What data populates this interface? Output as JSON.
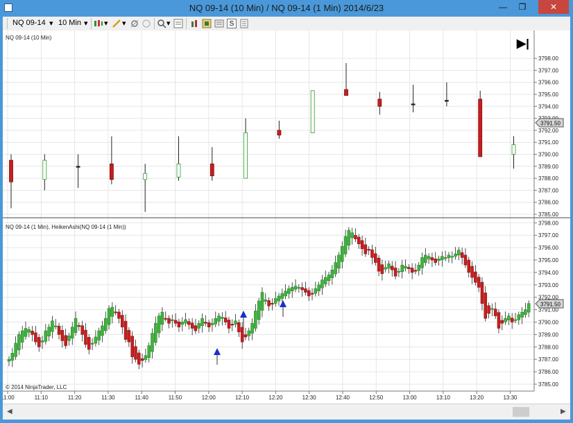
{
  "window": {
    "title": "NQ 09-14 (10 Min) / NQ 09-14 (1 Min)  2014/6/23",
    "min_glyph": "—",
    "restore_glyph": "❐",
    "close_glyph": "✕"
  },
  "toolbar": {
    "instrument": "NQ 09-14",
    "interval": "10 Min",
    "dropdown_glyph": "▾",
    "s_button": "S"
  },
  "panels": {
    "upper_label": "NQ 09-14 (10 Min)",
    "lower_label": "NQ 09-14 (1 Min), HeikenAshi(NQ 09-14 (1 Min))",
    "copyright": "© 2014 NinjaTrader, LLC",
    "price_marker": "3791.50",
    "go_to_end_glyph": "▶|"
  },
  "chart_data": [
    {
      "type": "candlestick",
      "title": "NQ 09-14 (10 Min)",
      "ylim": [
        3784.5,
        3798.3
      ],
      "y_ticks": [
        "3798.00",
        "3797.00",
        "3796.00",
        "3795.00",
        "3794.00",
        "3793.00",
        "3792.00",
        "3791.00",
        "3790.00",
        "3789.00",
        "3788.00",
        "3787.00",
        "3786.00",
        "3785.00"
      ],
      "last_price": 3791.5,
      "candles": [
        {
          "time": "11:00",
          "open": 3789.5,
          "close": 3787.7,
          "high": 3790.0,
          "low": 3785.5
        },
        {
          "time": "11:10",
          "open": 3787.9,
          "close": 3789.5,
          "high": 3790.0,
          "low": 3787.0
        },
        {
          "time": "11:20",
          "open": 3789.0,
          "close": 3789.0,
          "high": 3790.0,
          "low": 3787.2
        },
        {
          "time": "11:30",
          "open": 3789.2,
          "close": 3787.9,
          "high": 3791.5,
          "low": 3787.5
        },
        {
          "time": "11:40",
          "open": 3787.9,
          "close": 3788.4,
          "high": 3789.2,
          "low": 3785.2
        },
        {
          "time": "11:50",
          "open": 3788.1,
          "close": 3789.2,
          "high": 3791.5,
          "low": 3787.8
        },
        {
          "time": "12:00",
          "open": 3789.2,
          "close": 3788.2,
          "high": 3790.6,
          "low": 3787.8
        },
        {
          "time": "12:10",
          "open": 3788.0,
          "close": 3791.8,
          "high": 3793.0,
          "low": 3788.0
        },
        {
          "time": "12:20",
          "open": 3792.0,
          "close": 3791.6,
          "high": 3792.8,
          "low": 3791.3
        },
        {
          "time": "12:30",
          "open": 3791.8,
          "close": 3795.3,
          "high": 3795.3,
          "low": 3791.8
        },
        {
          "time": "12:40",
          "open": 3795.4,
          "close": 3794.9,
          "high": 3797.6,
          "low": 3794.9
        },
        {
          "time": "12:50",
          "open": 3794.6,
          "close": 3794.0,
          "high": 3795.2,
          "low": 3793.3
        },
        {
          "time": "13:00",
          "open": 3794.2,
          "close": 3794.2,
          "high": 3795.8,
          "low": 3793.5
        },
        {
          "time": "13:10",
          "open": 3794.5,
          "close": 3794.5,
          "high": 3796.0,
          "low": 3794.0
        },
        {
          "time": "13:20",
          "open": 3794.6,
          "close": 3789.8,
          "high": 3795.3,
          "low": 3789.8
        },
        {
          "time": "13:30",
          "open": 3790.0,
          "close": 3790.8,
          "high": 3791.5,
          "low": 3788.8
        }
      ]
    },
    {
      "type": "candlestick",
      "title": "NQ 09-14 (1 Min), HeikenAshi(NQ 09-14 (1 Min))",
      "ylim": [
        3784.6,
        3798.3
      ],
      "y_ticks": [
        "3798.00",
        "3797.00",
        "3796.00",
        "3795.00",
        "3794.00",
        "3793.00",
        "3792.00",
        "3791.00",
        "3790.00",
        "3789.00",
        "3788.00",
        "3787.00",
        "3786.00",
        "3785.00"
      ],
      "last_price": 3791.5,
      "x_ticks": [
        "11:00",
        "11:10",
        "11:20",
        "11:30",
        "11:40",
        "11:50",
        "12:00",
        "12:10",
        "12:20",
        "12:30",
        "12:40",
        "12:50",
        "13:00",
        "13:10",
        "13:20",
        "13:30"
      ],
      "closes": [
        3787.0,
        3787.5,
        3788.3,
        3789.0,
        3789.3,
        3789.5,
        3789.4,
        3789.0,
        3788.4,
        3788.0,
        3788.5,
        3789.3,
        3789.6,
        3790.1,
        3789.7,
        3789.0,
        3788.5,
        3788.1,
        3788.9,
        3789.6,
        3790.3,
        3789.7,
        3789.0,
        3788.2,
        3787.8,
        3788.3,
        3788.8,
        3789.3,
        3789.7,
        3790.3,
        3791.1,
        3791.2,
        3790.8,
        3790.3,
        3789.6,
        3788.6,
        3788.4,
        3787.2,
        3787.0,
        3786.6,
        3786.9,
        3787.3,
        3788.1,
        3789.1,
        3789.9,
        3790.5,
        3790.8,
        3790.3,
        3789.9,
        3790.2,
        3789.9,
        3789.6,
        3790.0,
        3790.2,
        3789.8,
        3789.5,
        3789.3,
        3789.9,
        3790.3,
        3789.9,
        3789.6,
        3789.9,
        3790.3,
        3790.5,
        3790.4,
        3790.0,
        3789.5,
        3789.8,
        3790.1,
        3789.2,
        3788.4,
        3788.8,
        3789.3,
        3789.9,
        3790.9,
        3791.7,
        3792.4,
        3791.8,
        3791.3,
        3791.5,
        3791.9,
        3792.1,
        3792.3,
        3792.5,
        3792.7,
        3792.8,
        3792.9,
        3792.8,
        3792.6,
        3792.4,
        3792.1,
        3792.3,
        3792.7,
        3793.0,
        3793.4,
        3793.6,
        3793.8,
        3794.2,
        3794.8,
        3795.4,
        3796.1,
        3796.9,
        3797.4,
        3797.2,
        3796.7,
        3796.3,
        3795.9,
        3795.5,
        3795.8,
        3795.2,
        3794.8,
        3794.1,
        3793.9,
        3794.4,
        3794.7,
        3794.2,
        3793.7,
        3794.1,
        3794.6,
        3794.5,
        3794.3,
        3794.0,
        3794.1,
        3794.6,
        3795.2,
        3795.4,
        3795.3,
        3795.0,
        3794.8,
        3795.1,
        3795.3,
        3795.2,
        3795.4,
        3795.3,
        3795.5,
        3795.8,
        3795.2,
        3794.6,
        3794.0,
        3793.6,
        3793.2,
        3792.8,
        3791.5,
        3790.3,
        3790.7,
        3791.1,
        3790.5,
        3789.5,
        3789.9,
        3790.3,
        3790.5,
        3790.0,
        3790.2,
        3790.6,
        3790.8,
        3791.0,
        3791.5
      ]
    }
  ]
}
